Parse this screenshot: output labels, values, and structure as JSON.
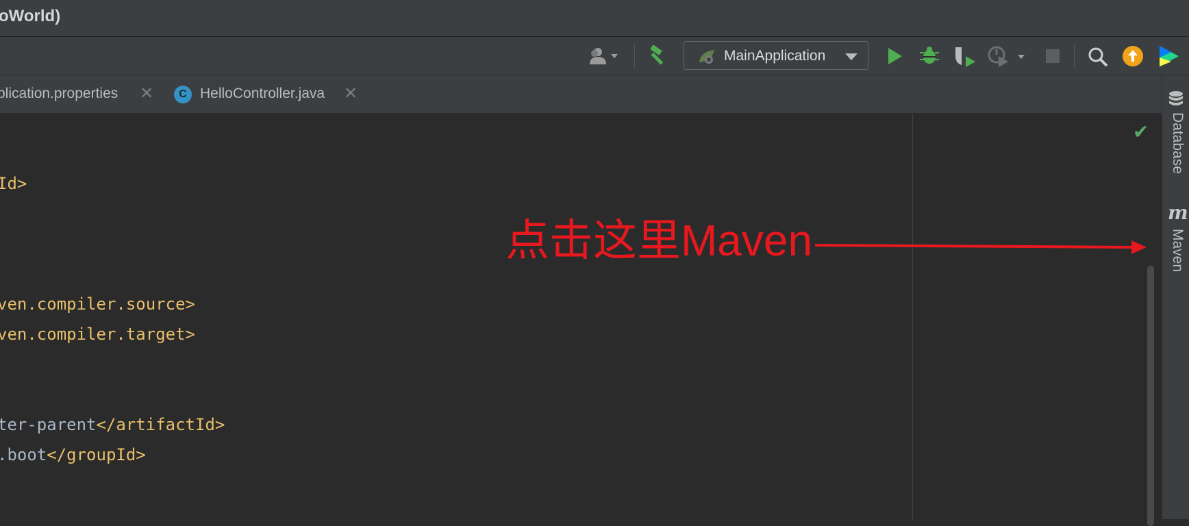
{
  "window": {
    "title": "oWorld)"
  },
  "toolbar": {
    "run_config_label": "MainApplication",
    "icons": [
      "user-icon",
      "chevron-down-icon",
      "build-hammer-icon",
      "run-icon",
      "debug-icon",
      "coverage-icon",
      "profile-icon",
      "stop-icon",
      "search-icon",
      "update-icon",
      "logo-icon"
    ]
  },
  "tabs": [
    {
      "label": "plication.properties",
      "close": "✕"
    },
    {
      "label": "HelloController.java",
      "close": "✕",
      "icon_letter": "C"
    }
  ],
  "editor": {
    "lines": [
      {
        "tag": "Id>"
      },
      {
        "tag": "ven.compiler.source>"
      },
      {
        "tag": "ven.compiler.target>"
      },
      {
        "plain": "ter-parent",
        "tag": "</artifactId>"
      },
      {
        "plain": ".boot",
        "tag": "</groupId>"
      }
    ]
  },
  "annotation": {
    "text": "点击这里Maven"
  },
  "right_panel": {
    "database_label": "Database",
    "maven_label": "Maven",
    "maven_icon_letter": "m"
  },
  "colors": {
    "annotation": "#e8181f",
    "run_green": "#4fae52",
    "tag_yellow": "#e8bf6a",
    "update_orange": "#f0a31b",
    "class_icon_blue": "#3592c4"
  }
}
